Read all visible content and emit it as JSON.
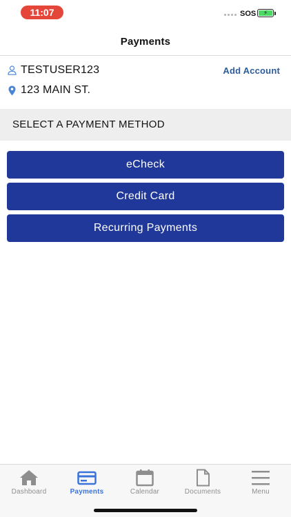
{
  "status_bar": {
    "time": "11:07",
    "sos": "SOS",
    "battery_bolt": "⚡"
  },
  "header": {
    "title": "Payments"
  },
  "account": {
    "user_icon": "person-icon",
    "username": "TESTUSER123",
    "address_icon": "location-pin-icon",
    "address": "123 MAIN ST.",
    "add_account_label": "Add Account"
  },
  "section": {
    "title": "SELECT A PAYMENT METHOD"
  },
  "methods": [
    {
      "label": "eCheck"
    },
    {
      "label": "Credit Card"
    },
    {
      "label": "Recurring Payments"
    }
  ],
  "tabs": [
    {
      "label": "Dashboard",
      "icon": "home-icon",
      "active": false
    },
    {
      "label": "Payments",
      "icon": "credit-card-icon",
      "active": true
    },
    {
      "label": "Calendar",
      "icon": "calendar-icon",
      "active": false
    },
    {
      "label": "Documents",
      "icon": "document-icon",
      "active": false
    },
    {
      "label": "Menu",
      "icon": "hamburger-menu-icon",
      "active": false
    }
  ],
  "colors": {
    "primary_button": "#1f3899",
    "link": "#2a5d9a",
    "active_tab": "#3a73d9",
    "inactive_tab": "#8e8e8e",
    "time_pill": "#e5463a",
    "section_bg": "#eeeeee"
  }
}
